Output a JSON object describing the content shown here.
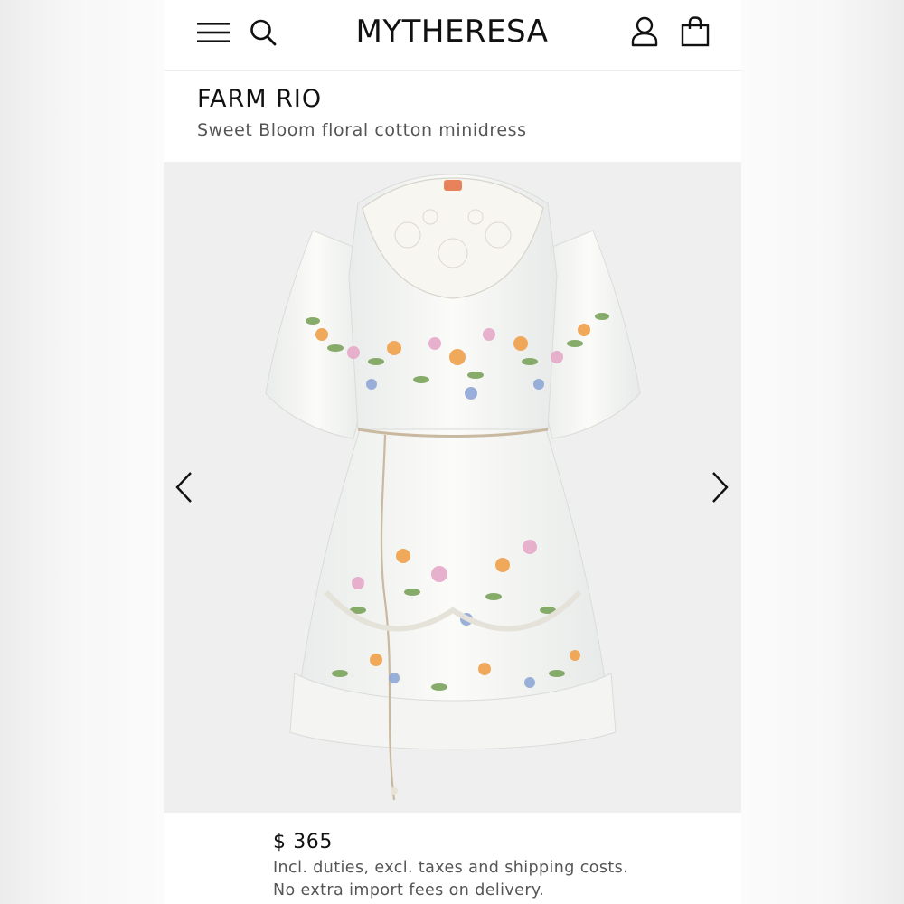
{
  "header": {
    "logo": "MYTHERESA",
    "icons": [
      "menu-icon",
      "search-icon",
      "account-icon",
      "shopping-bag-icon"
    ]
  },
  "product": {
    "brand": "FARM RIO",
    "name": "Sweet Bloom floral cotton minidress",
    "image_description_icon": "dress-image",
    "price": "$ 365",
    "price_note_1": "Incl. duties, excl. taxes and shipping costs.",
    "price_note_2": "No extra import fees on delivery."
  },
  "gallery": {
    "prev_icon": "chevron-left-icon",
    "next_icon": "chevron-right-icon"
  },
  "colors": {
    "text_primary": "#111111",
    "text_secondary": "#555555",
    "gallery_bg": "#efefef"
  }
}
